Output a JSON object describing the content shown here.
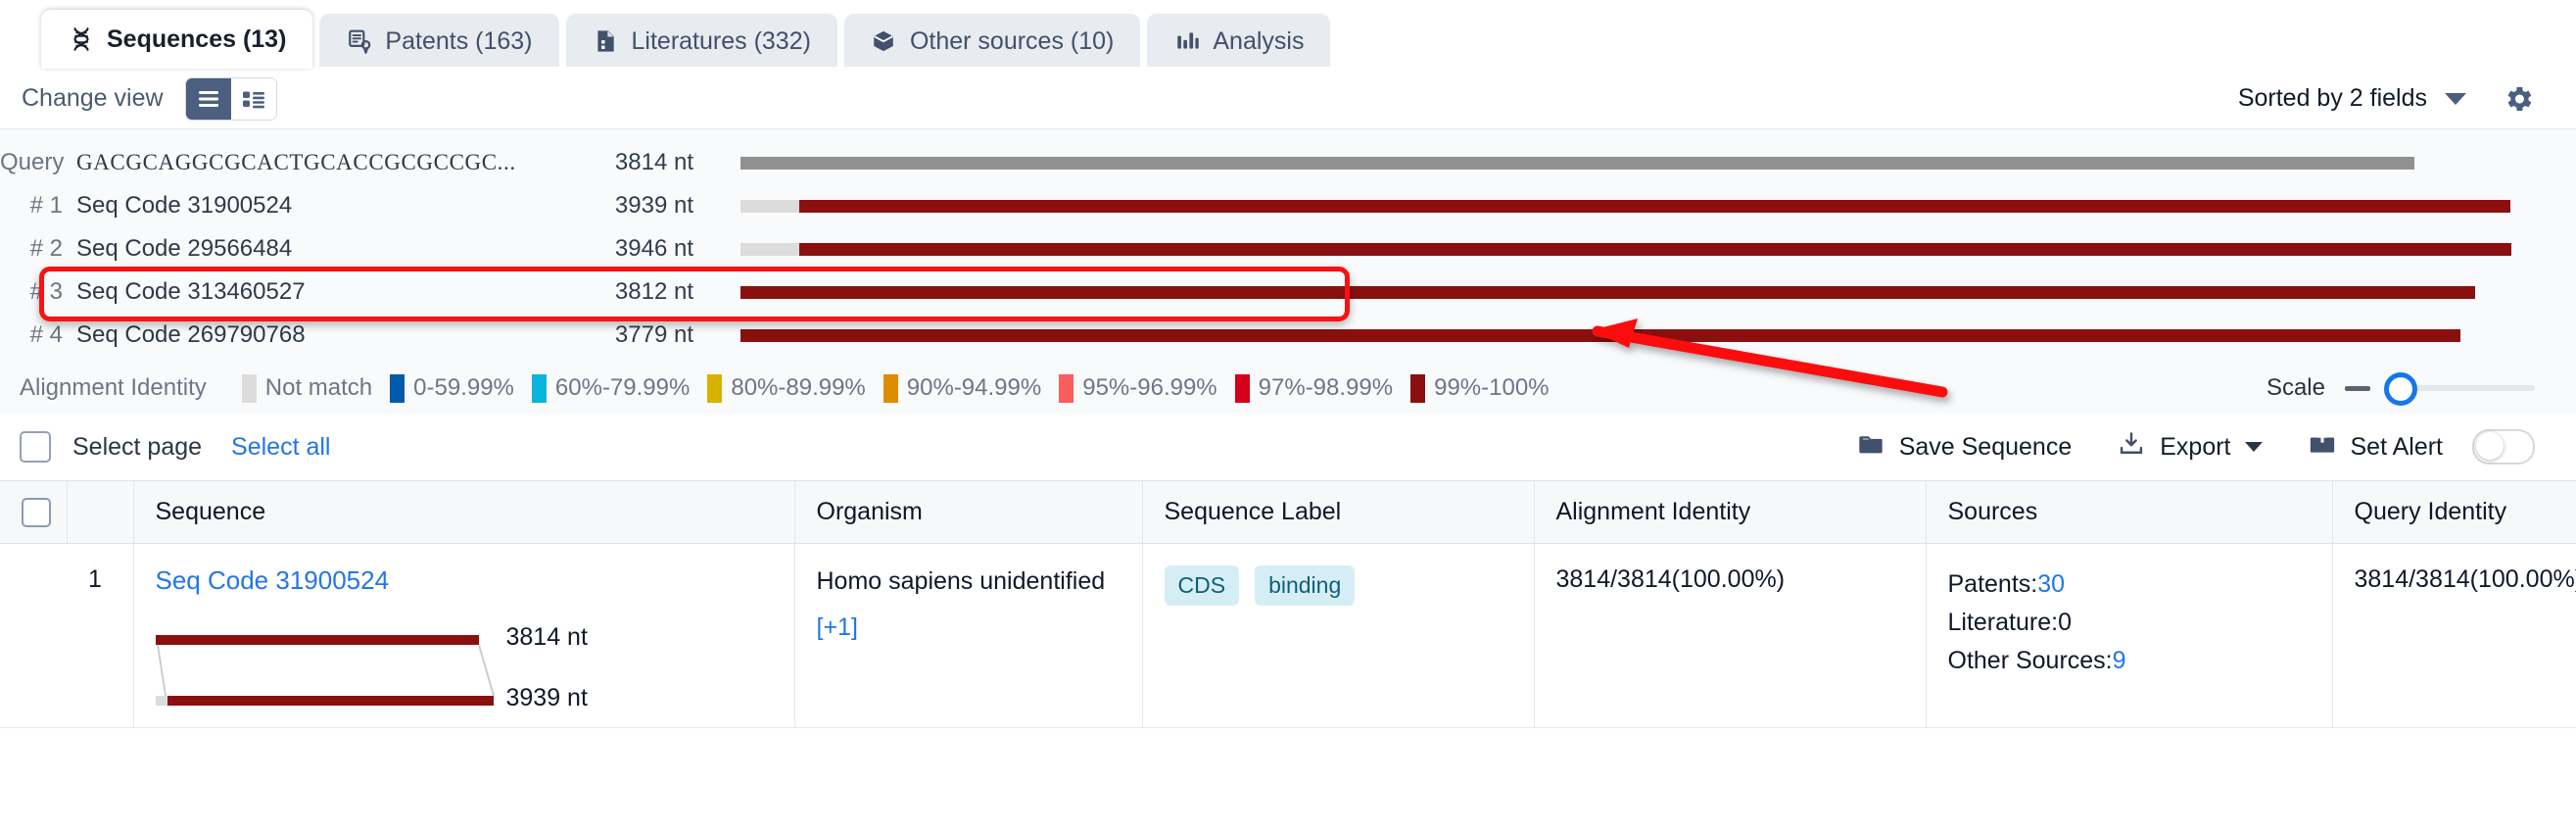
{
  "tabs": [
    {
      "label": "Sequences (13)",
      "icon": "dna-icon",
      "active": true
    },
    {
      "label": "Patents (163)",
      "icon": "patent-document-icon",
      "active": false
    },
    {
      "label": "Literatures (332)",
      "icon": "literature-document-icon",
      "active": false
    },
    {
      "label": "Other sources (10)",
      "icon": "cube-icon",
      "active": false
    },
    {
      "label": "Analysis",
      "icon": "bar-chart-icon",
      "active": false
    }
  ],
  "toolbar": {
    "change_view_label": "Change view",
    "view_list_icon": "list-view-icon",
    "view_card_icon": "card-view-icon",
    "sorted_by_label": "Sorted by 2 fields",
    "sort_caret_icon": "chevron-down-icon",
    "settings_icon": "gear-icon"
  },
  "alignment_map": {
    "query": {
      "rank": "Query",
      "name": "GACGCAGGCGCACTGCACCGCGCCGC...",
      "length": "3814 nt",
      "bar": {
        "start_pct": 0,
        "width_pct": 91.2,
        "color": "#919191"
      }
    },
    "hits": [
      {
        "rank": "# 1",
        "name": "Seq Code 31900524",
        "length": "3939 nt",
        "highlighted": false,
        "not_match": {
          "start_pct": 0,
          "width_pct": 3.2
        },
        "match": {
          "start_pct": 3.2,
          "width_pct": 93.2
        }
      },
      {
        "rank": "# 2",
        "name": "Seq Code 29566484",
        "length": "3946 nt",
        "highlighted": false,
        "not_match": {
          "start_pct": 0,
          "width_pct": 3.2
        },
        "match": {
          "start_pct": 3.2,
          "width_pct": 93.3
        }
      },
      {
        "rank": "# 3",
        "name": "Seq Code 313460527",
        "length": "3812 nt",
        "highlighted": true,
        "not_match": {
          "start_pct": 0,
          "width_pct": 0
        },
        "match": {
          "start_pct": 0,
          "width_pct": 94.5
        }
      },
      {
        "rank": "# 4",
        "name": "Seq Code 269790768",
        "length": "3779 nt",
        "highlighted": false,
        "not_match": {
          "start_pct": 0,
          "width_pct": 0
        },
        "match": {
          "start_pct": 0,
          "width_pct": 93.7
        }
      }
    ]
  },
  "legend": {
    "title": "Alignment Identity",
    "items": [
      {
        "label": "Not match",
        "color": "#dcdcdc"
      },
      {
        "label": "0-59.99%",
        "color": "#005baa"
      },
      {
        "label": "60%-79.99%",
        "color": "#0bb4dd"
      },
      {
        "label": "80%-89.99%",
        "color": "#d7b200"
      },
      {
        "label": "90%-94.99%",
        "color": "#e08c00"
      },
      {
        "label": "95%-96.99%",
        "color": "#fc5c5c"
      },
      {
        "label": "97%-98.99%",
        "color": "#d50019"
      },
      {
        "label": "99%-100%",
        "color": "#8a1010"
      }
    ],
    "scale_label": "Scale",
    "minus_icon": "minus-icon",
    "slider_value": 0
  },
  "select_bar": {
    "select_page_label": "Select page",
    "select_all_label": "Select all",
    "save_sequence_label": "Save Sequence",
    "save_icon": "folder-save-icon",
    "export_label": "Export",
    "export_icon": "download-icon",
    "export_caret_icon": "chevron-down-icon",
    "set_alert_label": "Set Alert",
    "alert_icon": "alert-upload-icon",
    "alert_toggle_on": false
  },
  "table": {
    "columns": [
      "Sequence",
      "Organism",
      "Sequence Label",
      "Alignment Identity",
      "Sources",
      "Query Identity"
    ],
    "rows": [
      {
        "index": "1",
        "sequence_name": "Seq Code 31900524",
        "minimap": {
          "query_len": "3814 nt",
          "subject_len": "3939 nt"
        },
        "organism": "Homo sapiens unidentified",
        "organism_more": "[+1]",
        "labels": [
          "CDS",
          "binding"
        ],
        "alignment_identity": "3814/3814(100.00%)",
        "sources": [
          {
            "label": "Patents:",
            "value": "30",
            "link": true
          },
          {
            "label": "Literature:",
            "value": "0",
            "link": false
          },
          {
            "label": "Other Sources:",
            "value": "9",
            "link": true
          }
        ],
        "query_identity": "3814/3814(100.00%)"
      }
    ]
  },
  "annotation": {
    "arrow_color": "#fb1111",
    "highlight_color": "#fb1111"
  }
}
